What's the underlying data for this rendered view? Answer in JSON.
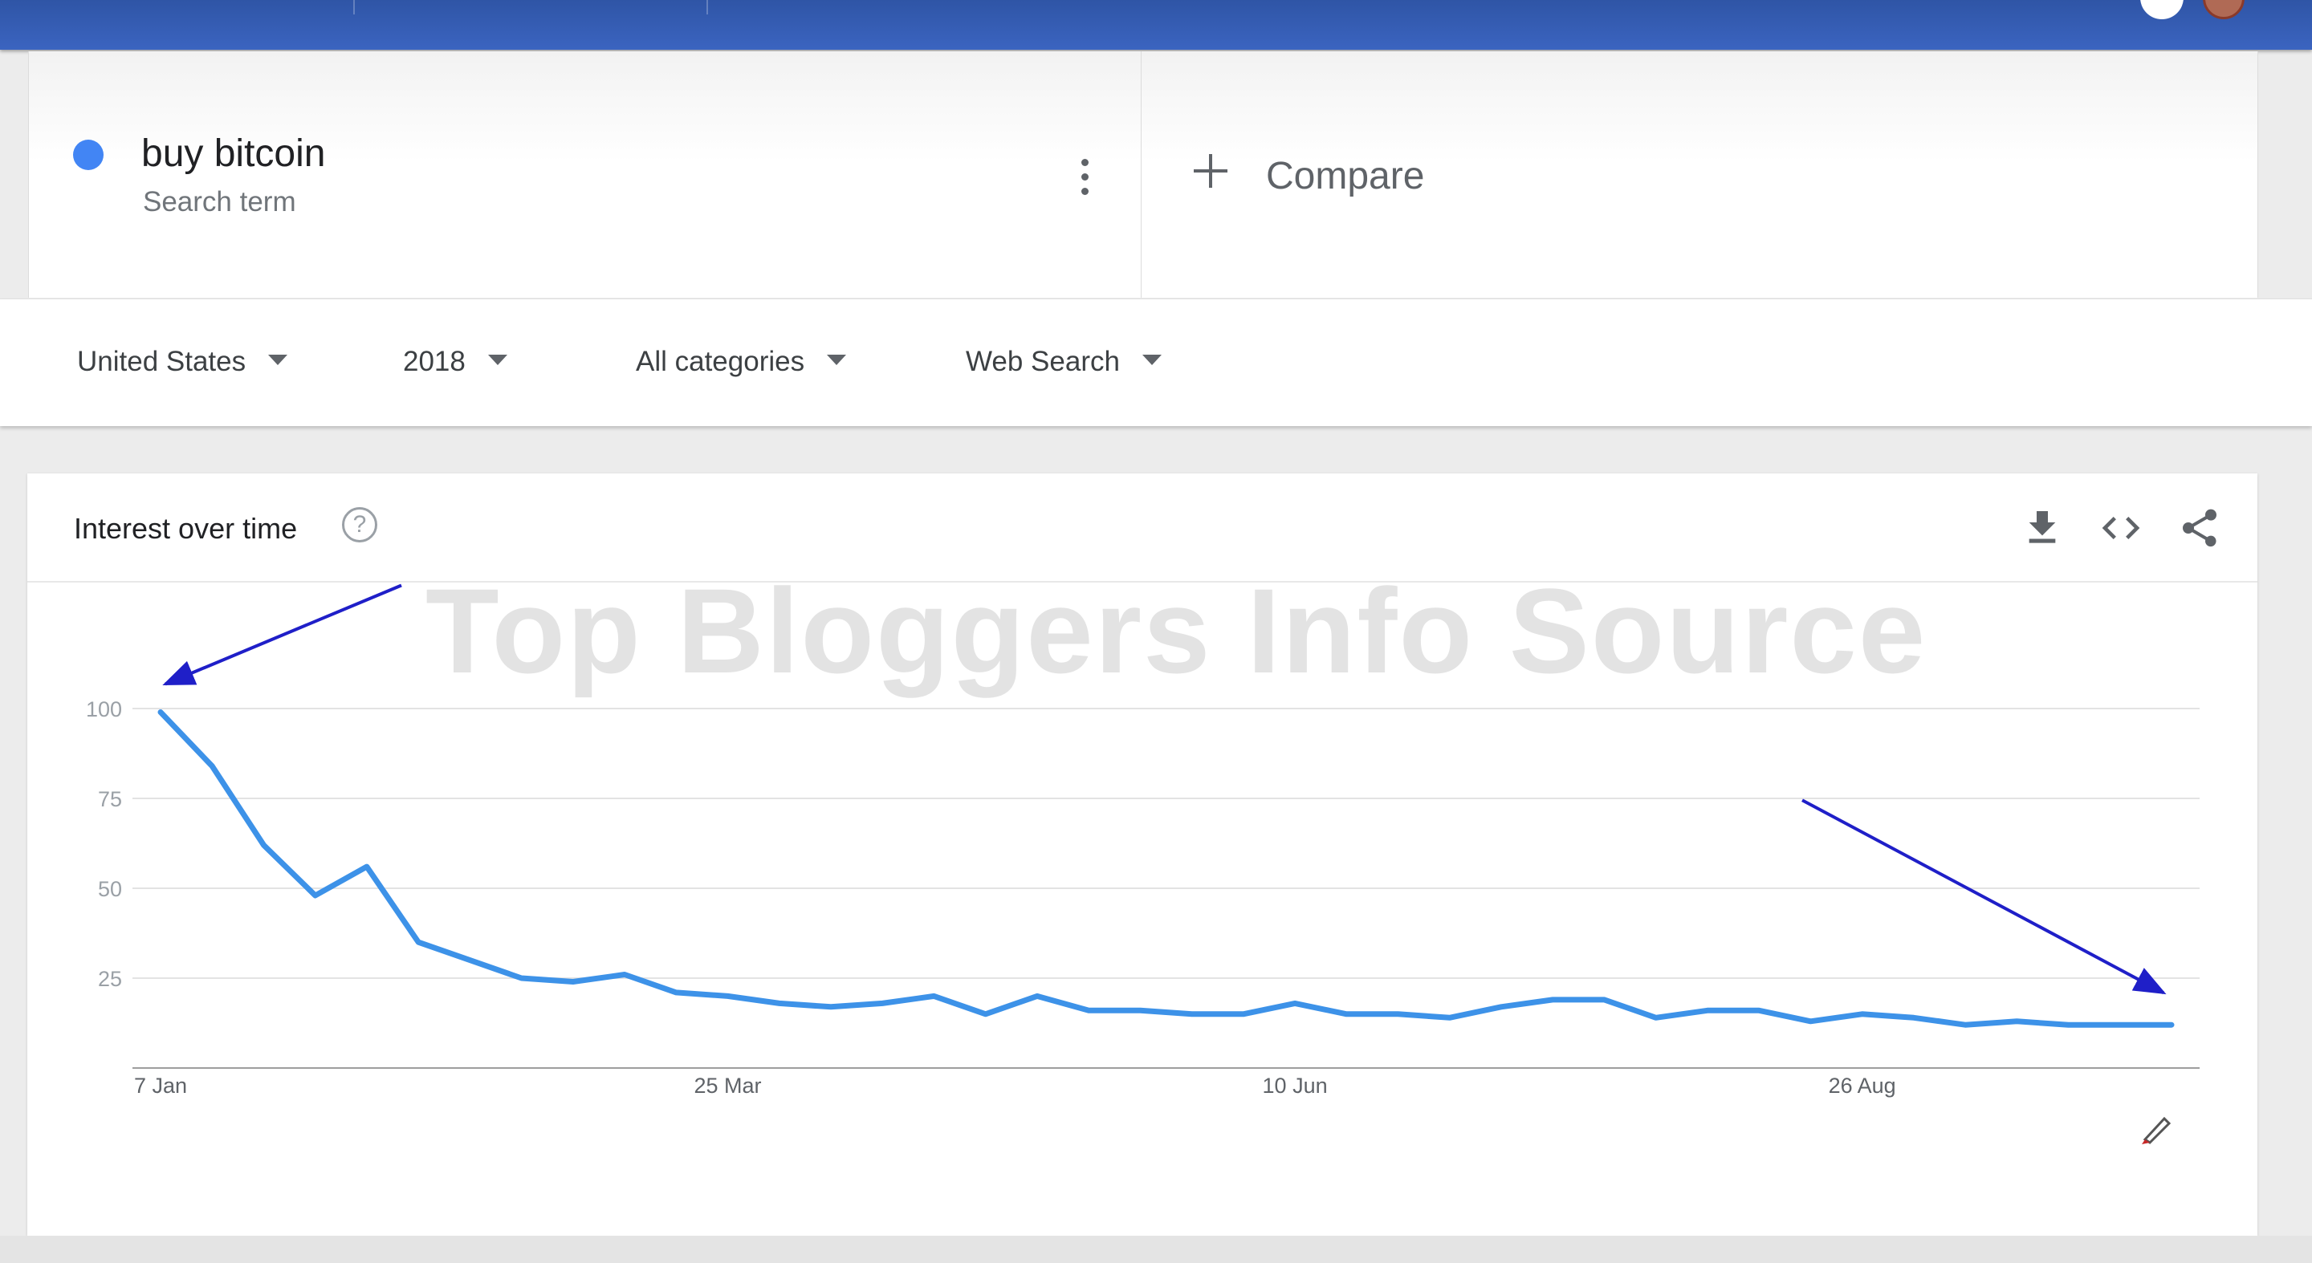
{
  "term": {
    "name": "buy bitcoin",
    "type_label": "Search term",
    "color": "#4285f4"
  },
  "compare": {
    "label": "Compare"
  },
  "filters": {
    "region": "United States",
    "period": "2018",
    "category": "All categories",
    "search_type": "Web Search"
  },
  "chart_header": {
    "title": "Interest over time",
    "help_glyph": "?",
    "icons": [
      "download-icon",
      "embed-code-icon",
      "share-icon"
    ]
  },
  "watermark": "Top Bloggers Info Source",
  "chart_data": {
    "type": "line",
    "x_tick_labels": [
      "7 Jan",
      "25 Mar",
      "10 Jun",
      "26 Aug"
    ],
    "y_ticks": [
      25,
      50,
      75,
      100
    ],
    "ylim": [
      0,
      100
    ],
    "grid": true,
    "series": [
      {
        "color": "#3d92e8",
        "x": [
          "7 Jan",
          "14 Jan",
          "21 Jan",
          "28 Jan",
          "4 Feb",
          "11 Feb",
          "18 Feb",
          "25 Feb",
          "4 Mar",
          "11 Mar",
          "18 Mar",
          "25 Mar",
          "1 Apr",
          "8 Apr",
          "15 Apr",
          "22 Apr",
          "29 Apr",
          "6 May",
          "13 May",
          "20 May",
          "27 May",
          "3 Jun",
          "10 Jun",
          "17 Jun",
          "24 Jun",
          "1 Jul",
          "8 Jul",
          "15 Jul",
          "22 Jul",
          "29 Jul",
          "5 Aug",
          "12 Aug",
          "19 Aug",
          "26 Aug",
          "2 Sep",
          "9 Sep",
          "16 Sep",
          "23 Sep",
          "30 Sep",
          "7 Oct"
        ],
        "values": [
          99,
          84,
          62,
          48,
          56,
          35,
          30,
          25,
          24,
          26,
          21,
          20,
          18,
          17,
          18,
          20,
          15,
          20,
          16,
          16,
          15,
          15,
          18,
          15,
          15,
          14,
          17,
          19,
          19,
          14,
          16,
          16,
          13,
          15,
          14,
          12,
          13,
          12,
          12,
          12
        ]
      }
    ],
    "annotation_color": "#1f1fc8"
  }
}
